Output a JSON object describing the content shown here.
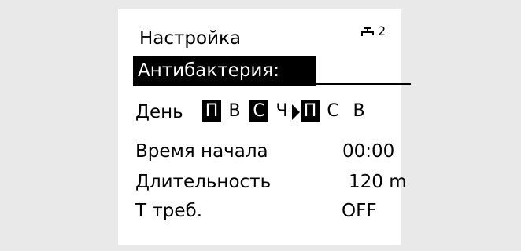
{
  "header": {
    "title": "Настройка",
    "circuit_number": "2",
    "icon": "tap-icon"
  },
  "screen_title": "Антибактерия:",
  "days": {
    "label": "День",
    "items": [
      {
        "label": "П",
        "highlighted": true
      },
      {
        "label": "В",
        "highlighted": false
      },
      {
        "label": "С",
        "highlighted": true
      },
      {
        "label": "Ч",
        "highlighted": false
      },
      {
        "label": "П",
        "highlighted": true,
        "selected_cursor": true
      },
      {
        "label": "С",
        "highlighted": false
      },
      {
        "label": "В",
        "highlighted": false
      }
    ]
  },
  "start_time": {
    "label": "Время начала",
    "value": "00:00"
  },
  "duration": {
    "label": "Длительность",
    "value": "120 m"
  },
  "temperature": {
    "label": "Т треб.",
    "value": "OFF"
  },
  "colors": {
    "background": "#e9e9e9",
    "screen": "#ffffff",
    "text": "#000000"
  }
}
